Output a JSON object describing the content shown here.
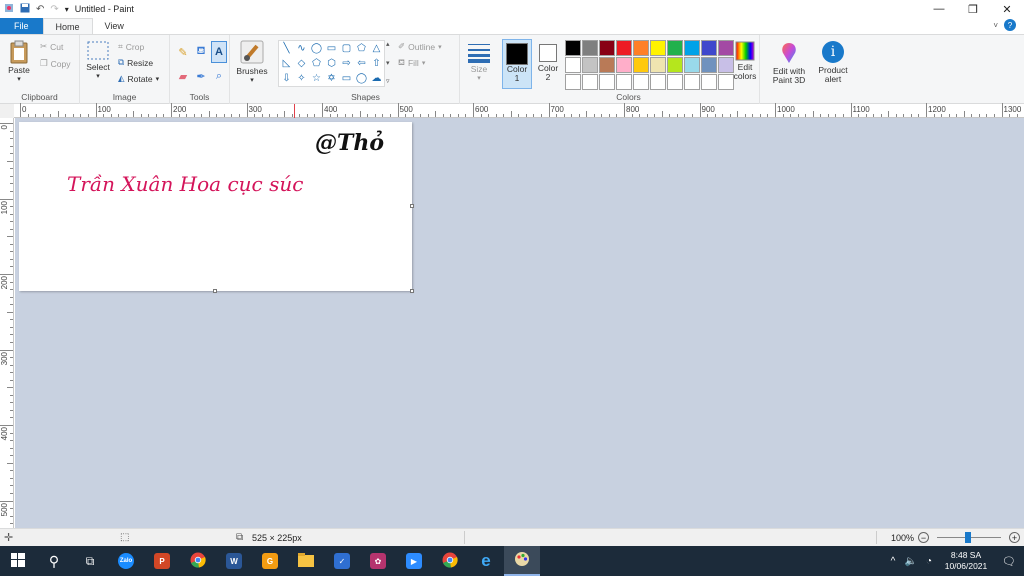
{
  "titlebar": {
    "title": "Untitled - Paint",
    "minimize": "—",
    "restore": "❐",
    "close": "✕"
  },
  "tabs": {
    "file": "File",
    "home": "Home",
    "view": "View",
    "help": "?"
  },
  "clipboard": {
    "paste": "Paste",
    "cut": "Cut",
    "copy": "Copy",
    "label": "Clipboard"
  },
  "image": {
    "select": "Select",
    "crop": "Crop",
    "resize": "Resize",
    "rotate": "Rotate",
    "label": "Image"
  },
  "tools": {
    "label": "Tools"
  },
  "brushes": {
    "label": "Brushes"
  },
  "shapes": {
    "outline": "Outline",
    "fill": "Fill",
    "label": "Shapes",
    "icons": [
      "line",
      "curve",
      "oval",
      "rectangle",
      "rounded-rectangle",
      "polygon",
      "triangle",
      "right-triangle",
      "diamond",
      "pentagon",
      "hexagon",
      "right-arrow",
      "left-arrow",
      "up-arrow",
      "down-arrow",
      "four-point-star",
      "five-point-star",
      "six-point-star",
      "rounded-callout",
      "oval-callout",
      "cloud-callout"
    ]
  },
  "size": {
    "label": "Size"
  },
  "colors": {
    "color1": "Color",
    "color1_num": "1",
    "color2": "Color",
    "color2_num": "2",
    "color1_value": "#000000",
    "color2_value": "#ffffff",
    "edit_colors_line1": "Edit",
    "edit_colors_line2": "colors",
    "label": "Colors",
    "palette": [
      "#000000",
      "#7f7f7f",
      "#880015",
      "#ed1c24",
      "#ff7f27",
      "#fff200",
      "#22b14c",
      "#00a2e8",
      "#3f48cc",
      "#a349a4",
      "#ffffff",
      "#c3c3c3",
      "#b97a57",
      "#ffaec9",
      "#ffc90e",
      "#efe4b0",
      "#b5e61d",
      "#99d9ea",
      "#7092be",
      "#c8bfe7"
    ]
  },
  "paint3d": {
    "line1": "Edit with",
    "line2": "Paint 3D"
  },
  "product_alert": {
    "line1": "Product",
    "line2": "alert"
  },
  "ruler_h": [
    "0",
    "100",
    "200",
    "300",
    "400",
    "500",
    "600",
    "700",
    "800",
    "900",
    "1000",
    "1100",
    "1200",
    "1300"
  ],
  "ruler_v": [
    "0",
    "100",
    "200",
    "300",
    "400",
    "500"
  ],
  "canvas": {
    "signature": "@Thỏ",
    "text": "Trần Xuân Hoa cục súc",
    "text_color": "#d4145a"
  },
  "status": {
    "size": "525 × 225px",
    "zoom": "100%"
  },
  "taskbar": {
    "apps": [
      "start",
      "search",
      "task-view",
      "zalo",
      "powerpoint",
      "chrome",
      "word",
      "app-orange",
      "file-explorer",
      "app-blue",
      "app-pink",
      "zoom",
      "chrome",
      "edge",
      "paint"
    ],
    "time": "8:48 SA",
    "date": "10/06/2021"
  }
}
